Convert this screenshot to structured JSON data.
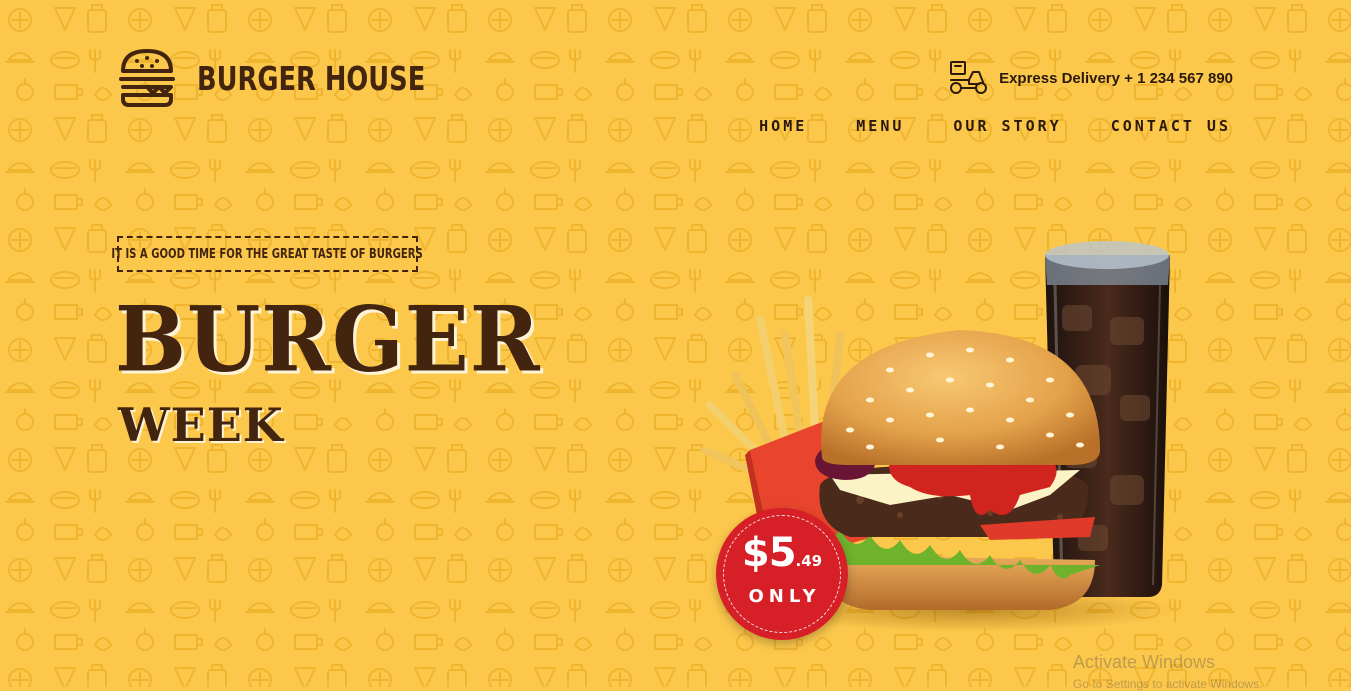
{
  "brand": {
    "name": "BURGER HOUSE",
    "logo_icon": "burger-icon"
  },
  "header": {
    "delivery_icon": "delivery-scooter-icon",
    "delivery_text": "Express Delivery + 1 234 567 890"
  },
  "nav": {
    "items": [
      {
        "label": "HOME"
      },
      {
        "label": "MENU"
      },
      {
        "label": "OUR STORY"
      },
      {
        "label": "CONTACT US"
      }
    ]
  },
  "hero": {
    "tagline": "IT IS A GOOD TIME FOR THE GREAT TASTE OF BURGERS",
    "title_line1": "BURGER",
    "title_line2": "WEEK"
  },
  "price": {
    "main": "$5",
    "cents": ".49",
    "suffix": "ONLY"
  },
  "watermark": {
    "line1": "Activate Windows",
    "line2": "Go to Settings to activate Windows."
  },
  "colors": {
    "background": "#fcc84b",
    "text_dark": "#43250f",
    "badge_red": "#d71f27",
    "pattern": "#f0b52f"
  }
}
